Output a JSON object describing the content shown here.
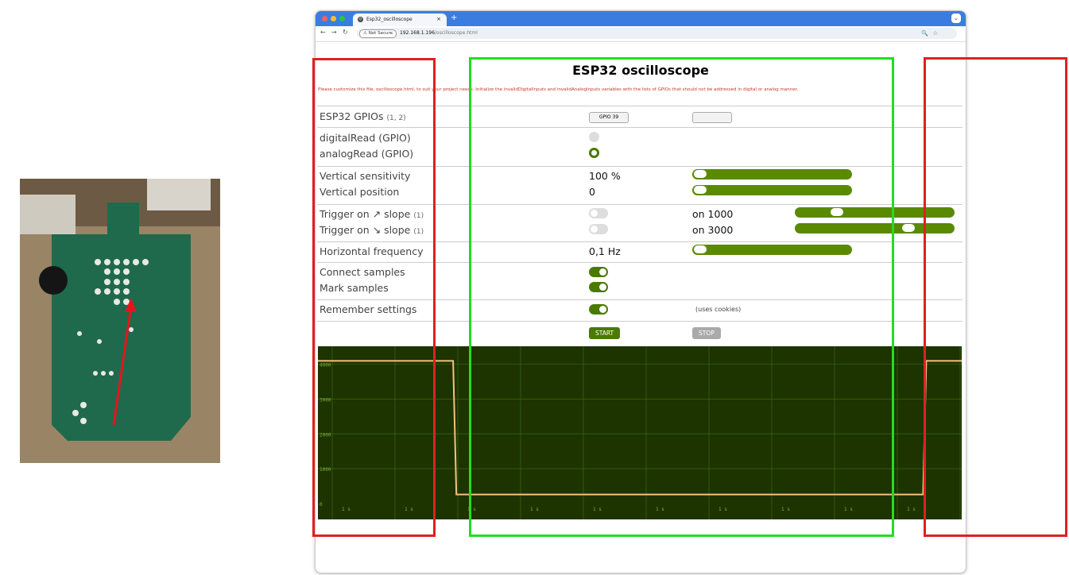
{
  "browser": {
    "tab_title": "Esp32_oscilloscope",
    "tab_close": "×",
    "new_tab": "+",
    "security_chip": "Not Secure",
    "url_host": "192.168.1.196",
    "url_path": "/oscilloscope.html"
  },
  "page": {
    "title": "ESP32 oscilloscope",
    "notice": "Please customize this file, oscilloscope.html, to suit your project needs. Initialize the invalidDigitalInputs and invalidAnalogInputs variables with the lists of GPIOs that should not be addressed in digital or analog manner."
  },
  "gpio": {
    "label": "ESP32 GPIOs",
    "refs": "(1, 2)",
    "button": "GPIO 39"
  },
  "read_mode": {
    "digital_label": "digitalRead (GPIO)",
    "analog_label": "analogRead (GPIO)",
    "selected": "analog"
  },
  "vertical": {
    "sensitivity_label": "Vertical sensitivity",
    "sensitivity_value": "100 %",
    "position_label": "Vertical position",
    "position_value": "0"
  },
  "trigger": {
    "rising_label": "Trigger on ↗ slope",
    "rising_ref": "(1)",
    "rising_value": "on 1000",
    "rising_level": 1000,
    "falling_label": "Trigger on ↘ slope",
    "falling_ref": "(1)",
    "falling_value": "on 3000",
    "falling_level": 3000
  },
  "horizontal": {
    "label": "Horizontal frequency",
    "value": "0,1 Hz"
  },
  "display": {
    "connect_label": "Connect samples",
    "mark_label": "Mark samples",
    "connect_on": true,
    "mark_on": true
  },
  "remember": {
    "label": "Remember settings",
    "note": "(uses cookies)",
    "on": true
  },
  "controls": {
    "start": "START",
    "stop": "STOP"
  },
  "colors": {
    "slider": "#5a8a00",
    "start": "#4a7a00",
    "stop": "#aaaaaa",
    "scope_bg": "#1d3300",
    "trace": "#f3c27d",
    "frame_green": "#22dd22",
    "frame_red": "#e02020"
  },
  "chart_data": {
    "type": "line",
    "y_ticks": [
      "4000",
      "3000",
      "2000",
      "1000",
      "0"
    ],
    "x_ticks": [
      "1 s",
      "1 s",
      "1 s",
      "1 s",
      "1 s",
      "1 s",
      "1 s",
      "1 s",
      "1 s",
      "1 s"
    ],
    "ylim": [
      0,
      4400
    ],
    "x": [
      0,
      21,
      21.5,
      94,
      94.5,
      100
    ],
    "y": [
      4095,
      4095,
      260,
      260,
      4095,
      4095
    ],
    "grid": true
  }
}
